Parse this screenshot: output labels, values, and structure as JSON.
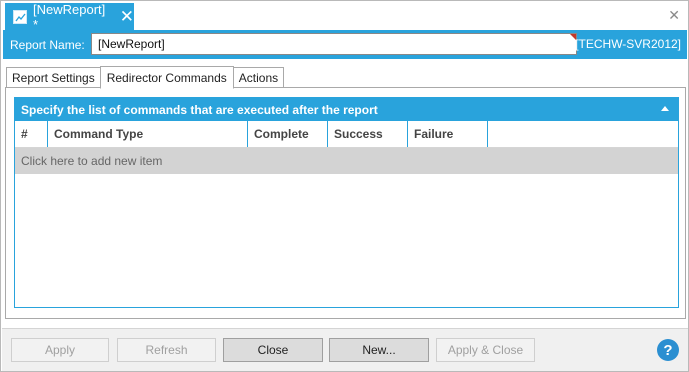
{
  "document_tab": {
    "title": "[NewReport] *",
    "close_glyph": "✕"
  },
  "window": {
    "close_glyph": "✕"
  },
  "report": {
    "name_label": "Report Name:",
    "name_value": "[NewReport]",
    "server": "[TECHW-SVR2012]"
  },
  "settings_tabs": [
    {
      "label": "Report Settings",
      "active": false
    },
    {
      "label": "Redirector Commands",
      "active": true
    },
    {
      "label": "Actions",
      "active": false
    }
  ],
  "grid": {
    "title": "Specify the list of commands that are executed after the report",
    "columns": [
      "#",
      "Command Type",
      "Complete",
      "Success",
      "Failure"
    ],
    "add_row_label": "Click here to add new item",
    "rows": []
  },
  "buttons": {
    "apply": "Apply",
    "refresh": "Refresh",
    "close": "Close",
    "new": "New...",
    "apply_close": "Apply & Close"
  },
  "help": {
    "glyph": "?"
  },
  "colors": {
    "accent": "#29a3dc",
    "help": "#2b8fd1"
  }
}
